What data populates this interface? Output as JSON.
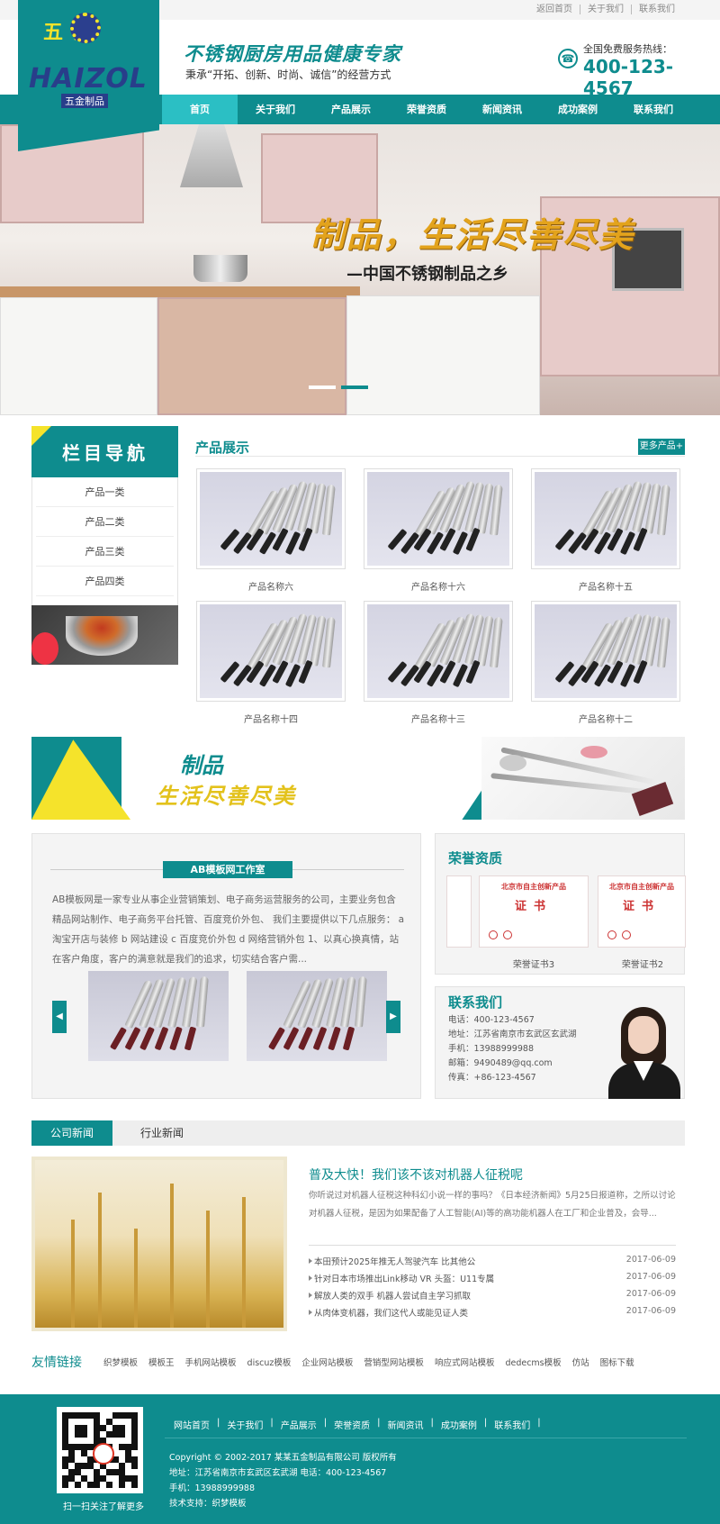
{
  "topbar": {
    "links": [
      "返回首页",
      "关于我们",
      "联系我们"
    ]
  },
  "logo": {
    "cn": "五 金",
    "en": "HAIZOL",
    "sub": "五金制品"
  },
  "header": {
    "slogan": "不锈钢厨房用品健康专家",
    "tagline": "秉承“开拓、创新、时尚、诚信”的经营方式",
    "phone_label": "全国免费服务热线：",
    "phone": "400-123-4567"
  },
  "nav": {
    "items": [
      "首页",
      "关于我们",
      "产品展示",
      "荣誉资质",
      "新闻资讯",
      "成功案例",
      "联系我们"
    ],
    "active": 0
  },
  "banner": {
    "title": "制品，生活尽善尽美",
    "subtitle": "—中国不锈钢制品之乡",
    "slides": 2,
    "current": 1
  },
  "sidebar": {
    "title": "栏目导航",
    "items": [
      "产品一类",
      "产品二类",
      "产品三类",
      "产品四类"
    ]
  },
  "products": {
    "title": "产品展示",
    "more": "更多产品+",
    "items": [
      "产品名称六",
      "产品名称十六",
      "产品名称十五",
      "产品名称十四",
      "产品名称十三",
      "产品名称十二"
    ]
  },
  "ad": {
    "line1": "制品",
    "line2": "生活尽善尽美"
  },
  "about": {
    "title": "AB模板网工作室",
    "text": "AB模板网是一家专业从事企业营销策划、电子商务运营服务的公司，主要业务包含精品网站制作、电子商务平台托管、百度竞价外包、 我们主要提供以下几点服务： a 淘宝开店与装修 b 网站建设 c 百度竞价外包 d 网络营销外包 1、以真心换真情，站在客户角度，客户的满意就是我们的追求，切实结合客户需..."
  },
  "honor": {
    "title": "荣誉资质",
    "cert_header": "北京市自主创新产品",
    "cert_body": "证书",
    "items": [
      "荣誉证书3",
      "荣誉证书2"
    ]
  },
  "contact": {
    "title": "联系我们",
    "lines": [
      "电话：400-123-4567",
      "地址：江苏省南京市玄武区玄武湖",
      "手机：13988999988",
      "邮箱：9490489@qq.com",
      "传真：+86-123-4567"
    ]
  },
  "news": {
    "tabs": [
      "公司新闻",
      "行业新闻"
    ],
    "headline": "普及大快！我们该不该对机器人征税呢",
    "desc": "你听说过对机器人征税这种科幻小说一样的事吗？《日本经济新闻》5月25日报道称，之所以讨论对机器人征税，是因为如果配备了人工智能(AI)等的高功能机器人在工厂和企业普及，会导...",
    "list": [
      {
        "title": "本田预计2025年推无人驾驶汽车 比其他公",
        "date": "2017-06-09"
      },
      {
        "title": "针对日本市场推出Link移动 VR 头盔：U11专属",
        "date": "2017-06-09"
      },
      {
        "title": "解放人类的双手 机器人尝试自主学习抓取",
        "date": "2017-06-09"
      },
      {
        "title": "从肉体变机器，我们这代人或能见证人类",
        "date": "2017-06-09"
      }
    ]
  },
  "friend_links": {
    "title": "友情链接",
    "items": [
      "织梦模板",
      "模板王",
      "手机网站模板",
      "discuz模板",
      "企业网站模板",
      "营销型网站模板",
      "响应式网站模板",
      "dedecms模板",
      "仿站",
      "图标下载"
    ]
  },
  "footer": {
    "qr_caption": "扫一扫关注了解更多",
    "links": [
      "网站首页",
      "关于我们",
      "产品展示",
      "荣誉资质",
      "新闻资讯",
      "成功案例",
      "联系我们"
    ],
    "copyright": "Copyright © 2002-2017 某某五金制品有限公司 版权所有",
    "address": "地址：江苏省南京市玄武区玄武湖 电话：400-123-4567",
    "mobile": "手机：13988999988",
    "support": "技术支持：织梦模板"
  },
  "colors": {
    "primary": "#0e8c8e",
    "accent": "#f5e32b",
    "nav_active": "#2bbfc4"
  },
  "icons": {
    "phone": "phone-icon",
    "arrow_left": "arrow-left-icon",
    "arrow_right": "arrow-right-icon"
  }
}
